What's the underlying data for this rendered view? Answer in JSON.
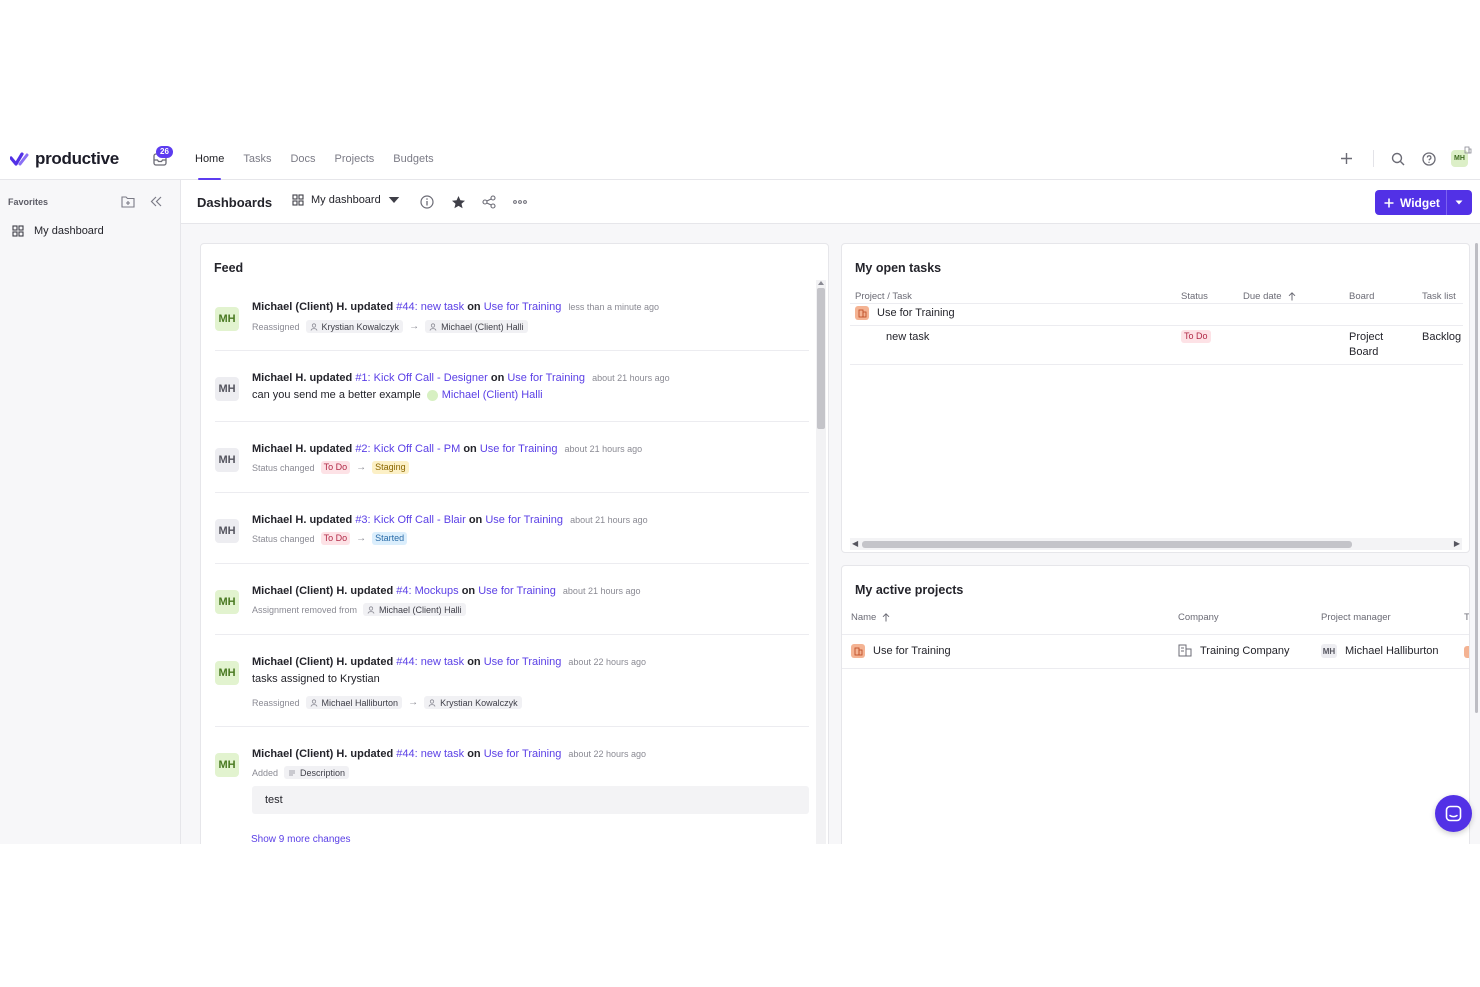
{
  "app": {
    "logo_text": "productive",
    "inbox_count": "26",
    "brand_color": "#5231e6"
  },
  "nav": {
    "tabs": [
      {
        "label": "Home",
        "active": true
      },
      {
        "label": "Tasks"
      },
      {
        "label": "Docs"
      },
      {
        "label": "Projects"
      },
      {
        "label": "Budgets"
      }
    ],
    "user_initials": "MH"
  },
  "sidebar": {
    "favorites_label": "Favorites",
    "items": [
      {
        "label": "My dashboard",
        "icon": "grid-icon"
      }
    ]
  },
  "dashboard": {
    "title": "Dashboards",
    "selected": "My dashboard",
    "widget_button": "Widget"
  },
  "feed": {
    "title": "Feed",
    "items": [
      {
        "initials": "MH",
        "avatar": "green",
        "actor": "Michael (Client) H. updated",
        "task": "#44: new task",
        "on": "on",
        "project": "Use for Training",
        "time": "less than a minute ago",
        "meta_label": "Reassigned",
        "from": "Krystian Kowalczyk",
        "to": "Michael (Client) Halli"
      },
      {
        "initials": "MH",
        "avatar": "gray",
        "actor": "Michael H. updated",
        "task": "#1: Kick Off Call - Designer",
        "on": "on",
        "project": "Use for Training",
        "time": "about 21 hours ago",
        "comment": "can you send me a better example",
        "mention": "Michael (Client) Halli"
      },
      {
        "initials": "MH",
        "avatar": "gray",
        "actor": "Michael H. updated",
        "task": "#2: Kick Off Call - PM",
        "on": "on",
        "project": "Use for Training",
        "time": "about 21 hours ago",
        "meta_label": "Status changed",
        "from": "To Do",
        "to": "Staging"
      },
      {
        "initials": "MH",
        "avatar": "gray",
        "actor": "Michael H. updated",
        "task": "#3: Kick Off Call - Blair",
        "on": "on",
        "project": "Use for Training",
        "time": "about 21 hours ago",
        "meta_label": "Status changed",
        "from": "To Do",
        "to": "Started"
      },
      {
        "initials": "MH",
        "avatar": "green",
        "actor": "Michael (Client) H. updated",
        "task": "#4: Mockups",
        "on": "on",
        "project": "Use for Training",
        "time": "about 21 hours ago",
        "meta_label": "Assignment removed from",
        "from": "Michael (Client) Halli"
      },
      {
        "initials": "MH",
        "avatar": "green",
        "actor": "Michael (Client) H. updated",
        "task": "#44: new task",
        "on": "on",
        "project": "Use for Training",
        "time": "about 22 hours ago",
        "comment": "tasks assigned to Krystian",
        "meta_label": "Reassigned",
        "from": "Michael Halliburton",
        "to": "Krystian Kowalczyk"
      },
      {
        "initials": "MH",
        "avatar": "green",
        "actor": "Michael (Client) H. updated",
        "task": "#44: new task",
        "on": "on",
        "project": "Use for Training",
        "time": "about 22 hours ago",
        "meta_label": "Added",
        "from": "Description",
        "quote": "test"
      }
    ],
    "show_more": "Show 9 more changes"
  },
  "open_tasks": {
    "title": "My open tasks",
    "columns": [
      "Project / Task",
      "Status",
      "Due date",
      "Board",
      "Task list"
    ],
    "project": "Use for Training",
    "rows": [
      {
        "task": "new task",
        "status": "To Do",
        "due": "",
        "board_line1": "Project",
        "board_line2": "Board",
        "task_list": "Backlog"
      }
    ]
  },
  "active_projects": {
    "title": "My active projects",
    "columns": [
      "Name",
      "Company",
      "Project manager",
      "T"
    ],
    "rows": [
      {
        "name": "Use for Training",
        "company": "Training Company",
        "pm_initials": "MH",
        "pm": "Michael Halliburton"
      }
    ]
  }
}
